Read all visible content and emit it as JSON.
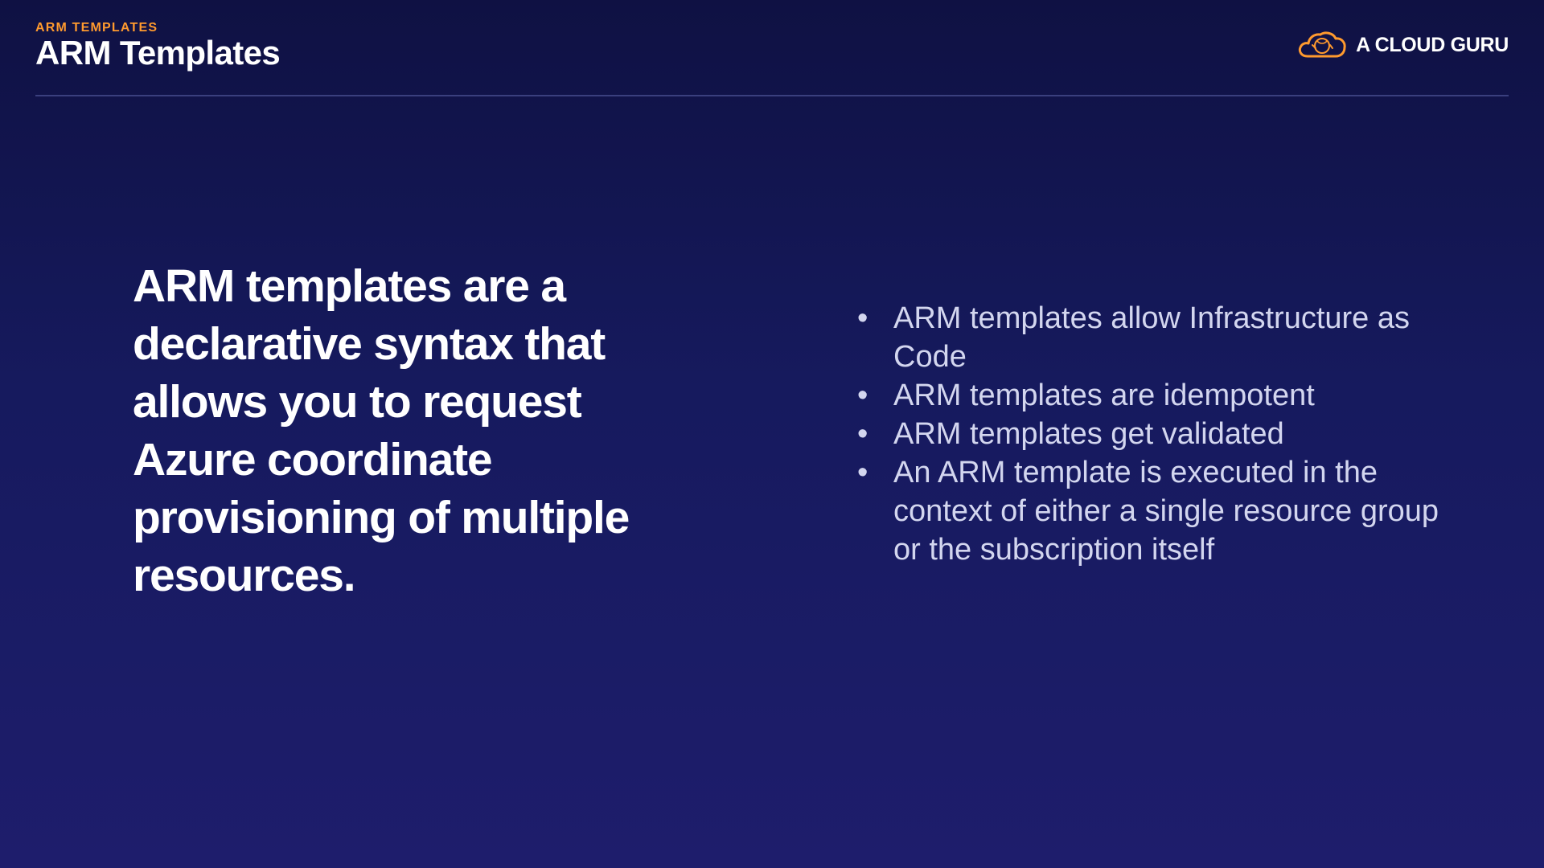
{
  "header": {
    "eyebrow": "ARM TEMPLATES",
    "title": "ARM Templates",
    "logo_text": "A CLOUD GURU",
    "logo_icon": "cloud-icon",
    "accent_color": "#ff9a2e"
  },
  "main": {
    "statement": "ARM templates are a declarative syntax that allows you to request Azure coordinate provisioning of multiple resources.",
    "bullet_marker": "•",
    "bullets": [
      "ARM templates allow Infrastructure as Code",
      "ARM templates are idempotent",
      "ARM templates get validated",
      "An ARM template is executed in the context of either a single resource group or the subscription itself"
    ]
  }
}
